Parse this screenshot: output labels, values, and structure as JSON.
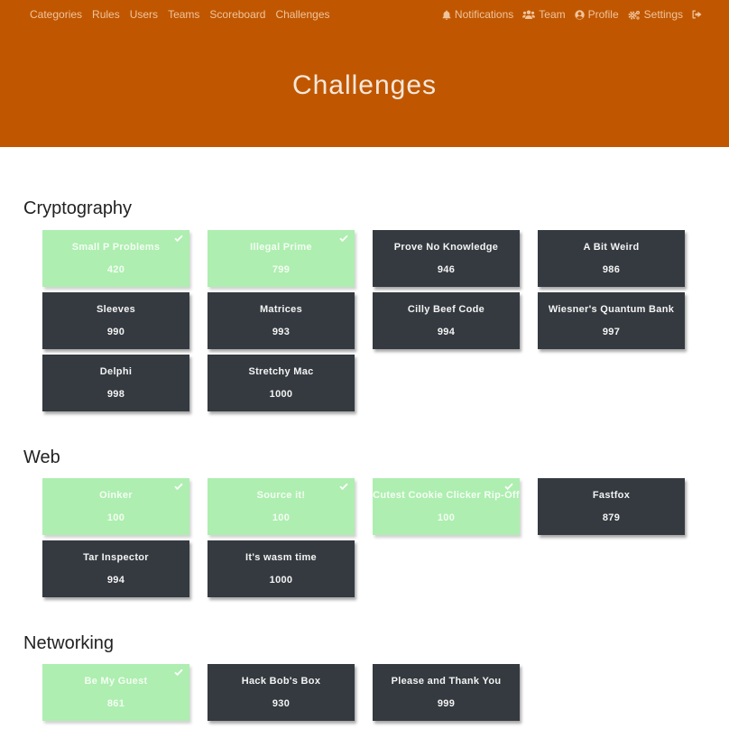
{
  "nav": {
    "left": [
      {
        "label": "Categories"
      },
      {
        "label": "Rules"
      },
      {
        "label": "Users"
      },
      {
        "label": "Teams"
      },
      {
        "label": "Scoreboard"
      },
      {
        "label": "Challenges"
      }
    ],
    "right": [
      {
        "label": "Notifications",
        "icon": "bell-icon"
      },
      {
        "label": "Team",
        "icon": "users-icon"
      },
      {
        "label": "Profile",
        "icon": "user-circle-icon"
      },
      {
        "label": "Settings",
        "icon": "gears-icon"
      },
      {
        "label": "",
        "icon": "logout-icon"
      }
    ]
  },
  "page": {
    "title": "Challenges"
  },
  "colors": {
    "brand": "#c05700",
    "solved": "#aeeeb0",
    "unsolved": "#343a40"
  },
  "categories": [
    {
      "name": "Cryptography",
      "challenges": [
        {
          "name": "Small P Problems",
          "points": "420",
          "solved": true
        },
        {
          "name": "Illegal Prime",
          "points": "799",
          "solved": true
        },
        {
          "name": "Prove No Knowledge",
          "points": "946",
          "solved": false
        },
        {
          "name": "A Bit Weird",
          "points": "986",
          "solved": false
        },
        {
          "name": "Sleeves",
          "points": "990",
          "solved": false
        },
        {
          "name": "Matrices",
          "points": "993",
          "solved": false
        },
        {
          "name": "Cilly Beef Code",
          "points": "994",
          "solved": false
        },
        {
          "name": "Wiesner's Quantum Bank",
          "points": "997",
          "solved": false
        },
        {
          "name": "Delphi",
          "points": "998",
          "solved": false
        },
        {
          "name": "Stretchy Mac",
          "points": "1000",
          "solved": false
        }
      ]
    },
    {
      "name": "Web",
      "challenges": [
        {
          "name": "Oinker",
          "points": "100",
          "solved": true
        },
        {
          "name": "Source it!",
          "points": "100",
          "solved": true
        },
        {
          "name": "Cutest Cookie Clicker Rip-Off",
          "points": "100",
          "solved": true
        },
        {
          "name": "Fastfox",
          "points": "879",
          "solved": false
        },
        {
          "name": "Tar Inspector",
          "points": "994",
          "solved": false
        },
        {
          "name": "It's wasm time",
          "points": "1000",
          "solved": false
        }
      ]
    },
    {
      "name": "Networking",
      "challenges": [
        {
          "name": "Be My Guest",
          "points": "861",
          "solved": true
        },
        {
          "name": "Hack Bob's Box",
          "points": "930",
          "solved": false
        },
        {
          "name": "Please and Thank You",
          "points": "999",
          "solved": false
        }
      ]
    }
  ]
}
